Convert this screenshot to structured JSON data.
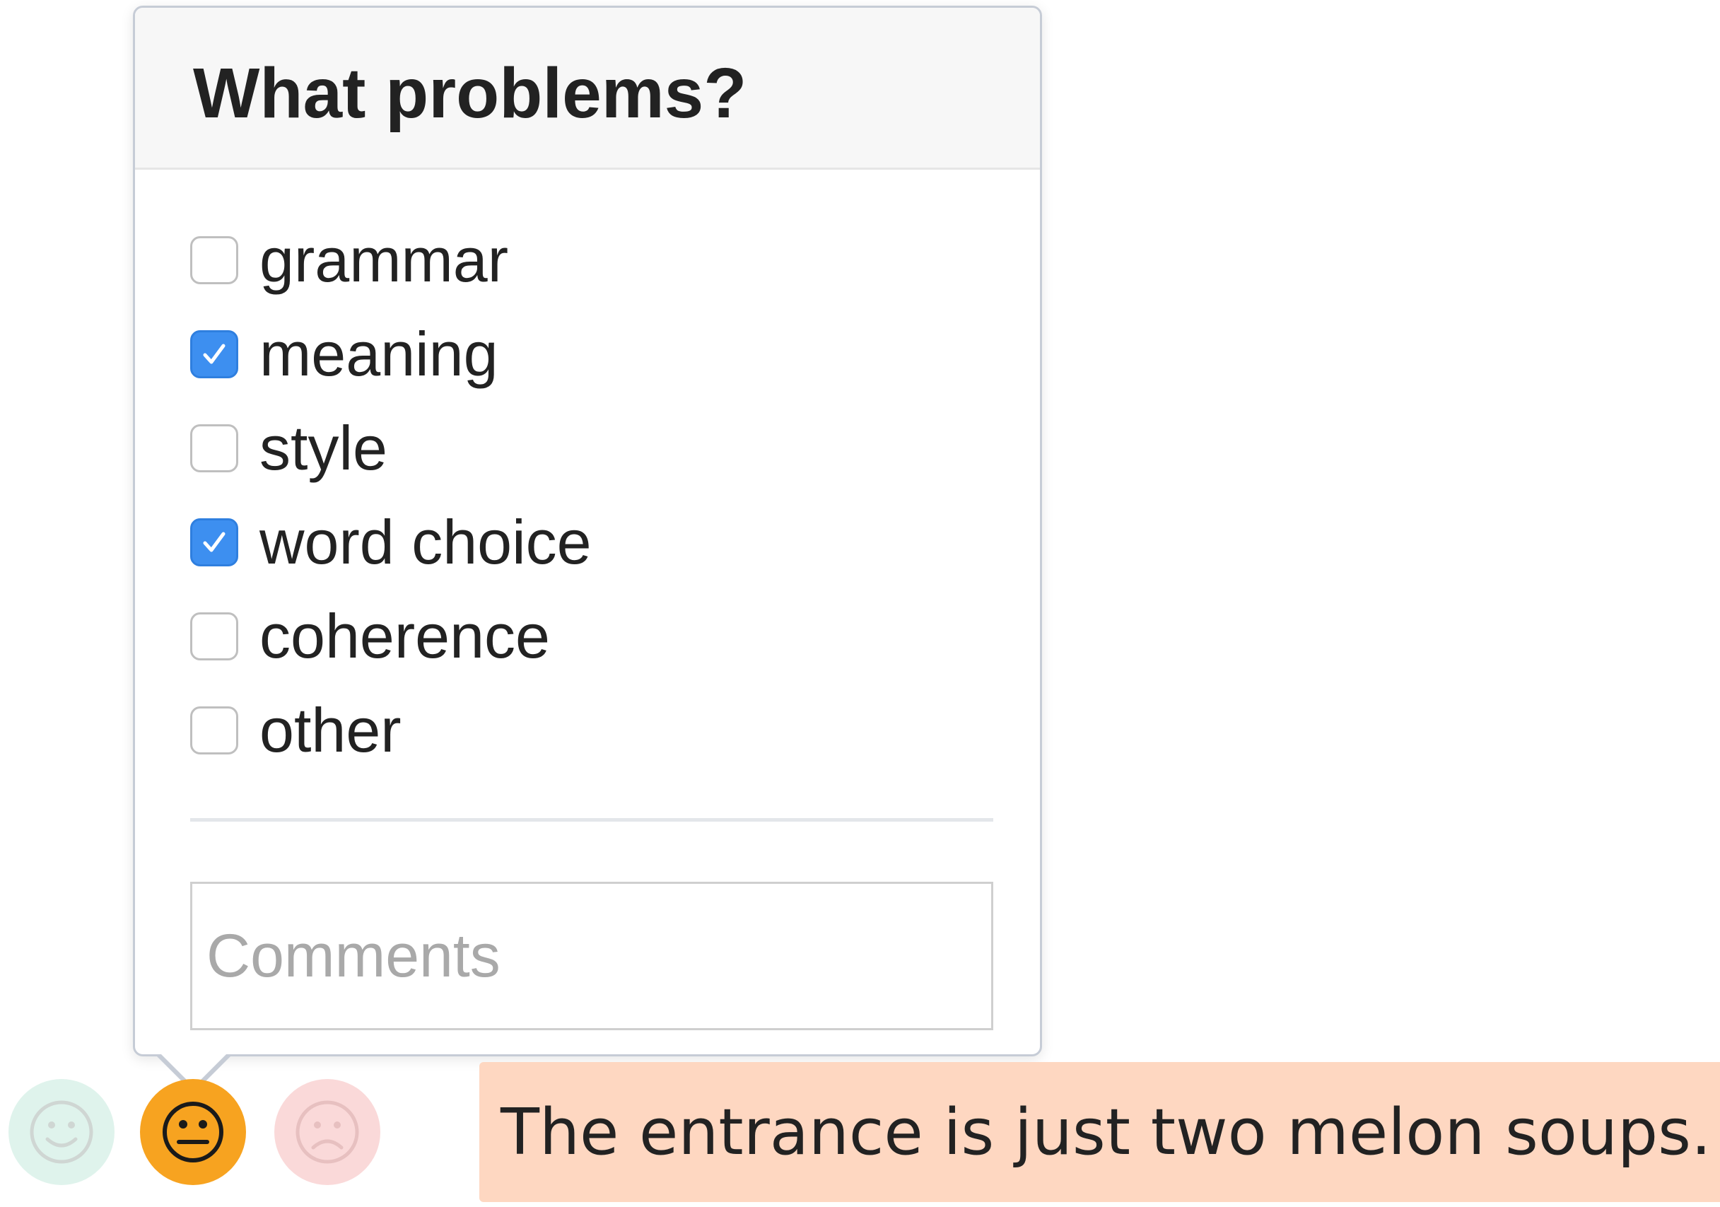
{
  "popover": {
    "title": "What problems?",
    "options": [
      {
        "label": "grammar",
        "checked": false
      },
      {
        "label": "meaning",
        "checked": true
      },
      {
        "label": "style",
        "checked": false
      },
      {
        "label": "word choice",
        "checked": true
      },
      {
        "label": "coherence",
        "checked": false
      },
      {
        "label": "other",
        "checked": false
      }
    ],
    "comments": {
      "value": "",
      "placeholder": "Comments"
    }
  },
  "ratings": [
    {
      "name": "happy",
      "icon": "smiley-face-icon",
      "selected": false,
      "color": "#dff3ec"
    },
    {
      "name": "neutral",
      "icon": "neutral-face-icon",
      "selected": true,
      "color": "#f7a320"
    },
    {
      "name": "sad",
      "icon": "frowning-face-icon",
      "selected": false,
      "color": "#fad9d9"
    }
  ],
  "sentence": {
    "text": "The entrance is just two melon soups.",
    "highlight_color": "#fed7c1"
  },
  "colors": {
    "checkbox_checked": "#3d8ff0",
    "accent": "#f7a320"
  }
}
